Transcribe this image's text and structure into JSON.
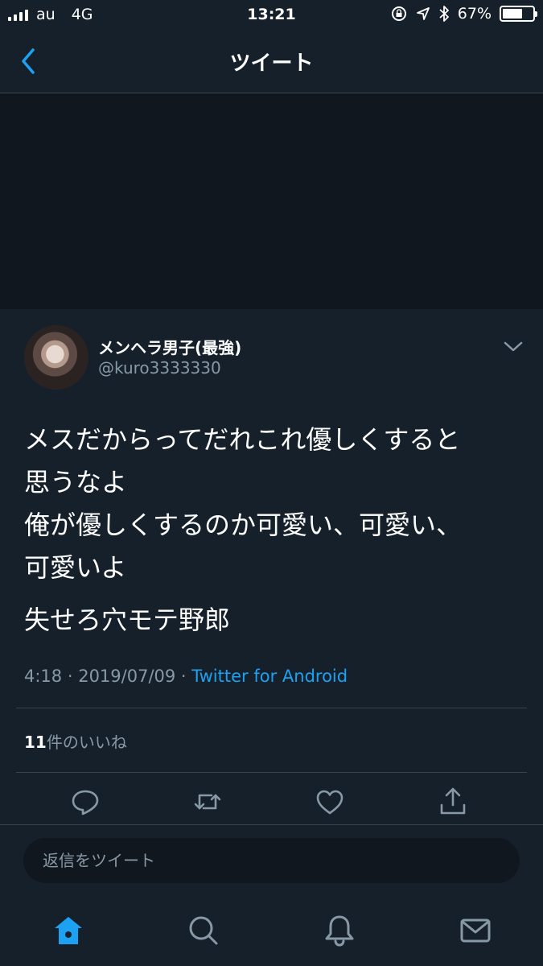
{
  "status_bar": {
    "carrier": "au",
    "network": "4G",
    "time": "13:21",
    "battery_percent": "67%",
    "battery_level": 0.67,
    "icons": [
      "signal-icon",
      "orientation-lock-icon",
      "location-icon",
      "bluetooth-icon",
      "battery-icon"
    ]
  },
  "header": {
    "title": "ツイート",
    "back_icon": "chevron-left-icon"
  },
  "tweet": {
    "author": {
      "name": "メンヘラ男子(最強)",
      "handle": "@kuro3333330"
    },
    "text": {
      "paragraph1_line1": "メスだからってだれこれ優しくすると",
      "paragraph1_line2": "思うなよ",
      "paragraph1_line3": "俺が優しくするのか可愛い、可愛い、",
      "paragraph1_line4": "可愛いよ",
      "paragraph2": "失せろ穴モテ野郎"
    },
    "time": "4:18",
    "date": "2019/07/09",
    "separator": " · ",
    "source": "Twitter for Android",
    "likes_count": "11",
    "likes_label": "件のいいね",
    "actions": [
      "reply-icon",
      "retweet-icon",
      "like-icon",
      "share-icon"
    ]
  },
  "reply": {
    "placeholder": "返信をツイート"
  },
  "tabbar": {
    "tabs": [
      "home-icon",
      "search-icon",
      "notifications-icon",
      "messages-icon"
    ],
    "active": "home-icon"
  },
  "colors": {
    "background": "#15202b",
    "media_background": "#10171e",
    "divider": "#38444d",
    "secondary_text": "#8899a6",
    "accent": "#1da1f2"
  }
}
